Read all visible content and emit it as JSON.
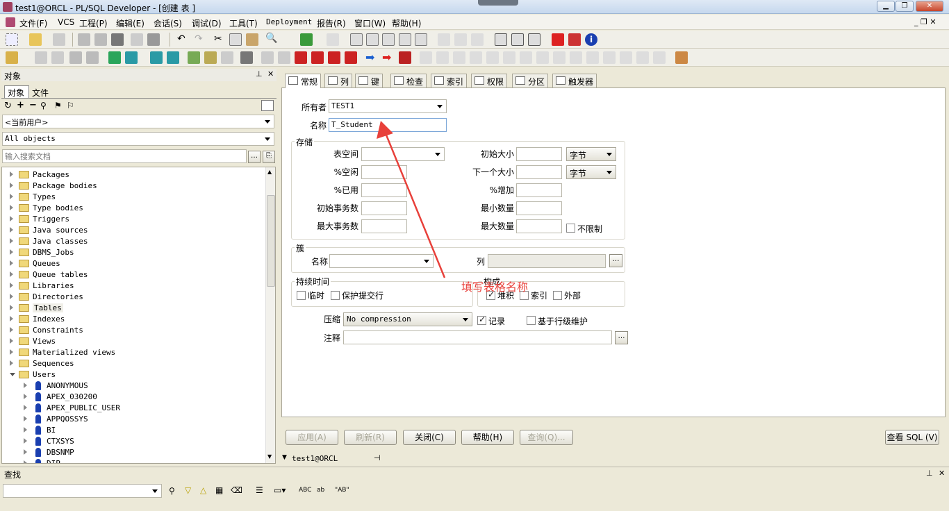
{
  "window": {
    "title": "test1@ORCL - PL/SQL Developer - [创建 表 ]"
  },
  "menu": [
    "文件(F)",
    "VCS",
    "工程(P)",
    "编辑(E)",
    "会话(S)",
    "调试(D)",
    "工具(T)",
    "Deployment",
    "报告(R)",
    "窗口(W)",
    "帮助(H)"
  ],
  "left": {
    "title": "对象",
    "tabs": [
      "对象",
      "文件"
    ],
    "user_select": "<当前用户>",
    "filter_select": "All objects",
    "search_placeholder": "输入搜索文档",
    "tree": [
      "Packages",
      "Package bodies",
      "Types",
      "Type bodies",
      "Triggers",
      "Java sources",
      "Java classes",
      "DBMS_Jobs",
      "Queues",
      "Queue tables",
      "Libraries",
      "Directories",
      "Tables",
      "Indexes",
      "Constraints",
      "Views",
      "Materialized views",
      "Sequences",
      "Users"
    ],
    "users": [
      "ANONYMOUS",
      "APEX_030200",
      "APEX_PUBLIC_USER",
      "APPQOSSYS",
      "BI",
      "CTXSYS",
      "DBSNMP",
      "DIP"
    ]
  },
  "tabs": [
    "常规",
    "列",
    "键",
    "检查",
    "索引",
    "权限",
    "分区",
    "触发器"
  ],
  "form": {
    "owner_label": "所有者",
    "owner_value": "TEST1",
    "name_label": "名称",
    "name_value": "T_Student",
    "storage_title": "存储",
    "tablespace_label": "表空间",
    "pctfree_label": "%空闲",
    "pctused_label": "%已用",
    "initrans_label": "初始事务数",
    "maxtrans_label": "最大事务数",
    "initial_label": "初始大小",
    "initial_unit": "字节",
    "next_label": "下一个大小",
    "next_unit": "字节",
    "pctincrease_label": "%增加",
    "minextents_label": "最小数量",
    "maxextents_label": "最大数量",
    "unlimited_label": "不限制",
    "cluster_title": "簇",
    "cluster_name_label": "名称",
    "cluster_col_label": "列",
    "duration_title": "持续时间",
    "temporary_label": "临时",
    "preserve_label": "保护提交行",
    "org_title": "构成",
    "heap_label": "堆积",
    "index_label": "索引",
    "external_label": "外部",
    "compress_label": "压缩",
    "compress_value": "No compression",
    "logging_label": "记录",
    "rowdep_label": "基于行级维护",
    "comment_label": "注释"
  },
  "annotation": "填写表格名称",
  "buttons": {
    "apply": "应用(A)",
    "refresh": "刷新(R)",
    "close": "关闭(C)",
    "help": "帮助(H)",
    "query": "查询(Q)...",
    "view_sql": "查看 SQL (V)"
  },
  "status": {
    "connection": "test1@ORCL"
  },
  "find": {
    "title": "查找"
  },
  "colors": {
    "arrow": "#e8403a"
  }
}
